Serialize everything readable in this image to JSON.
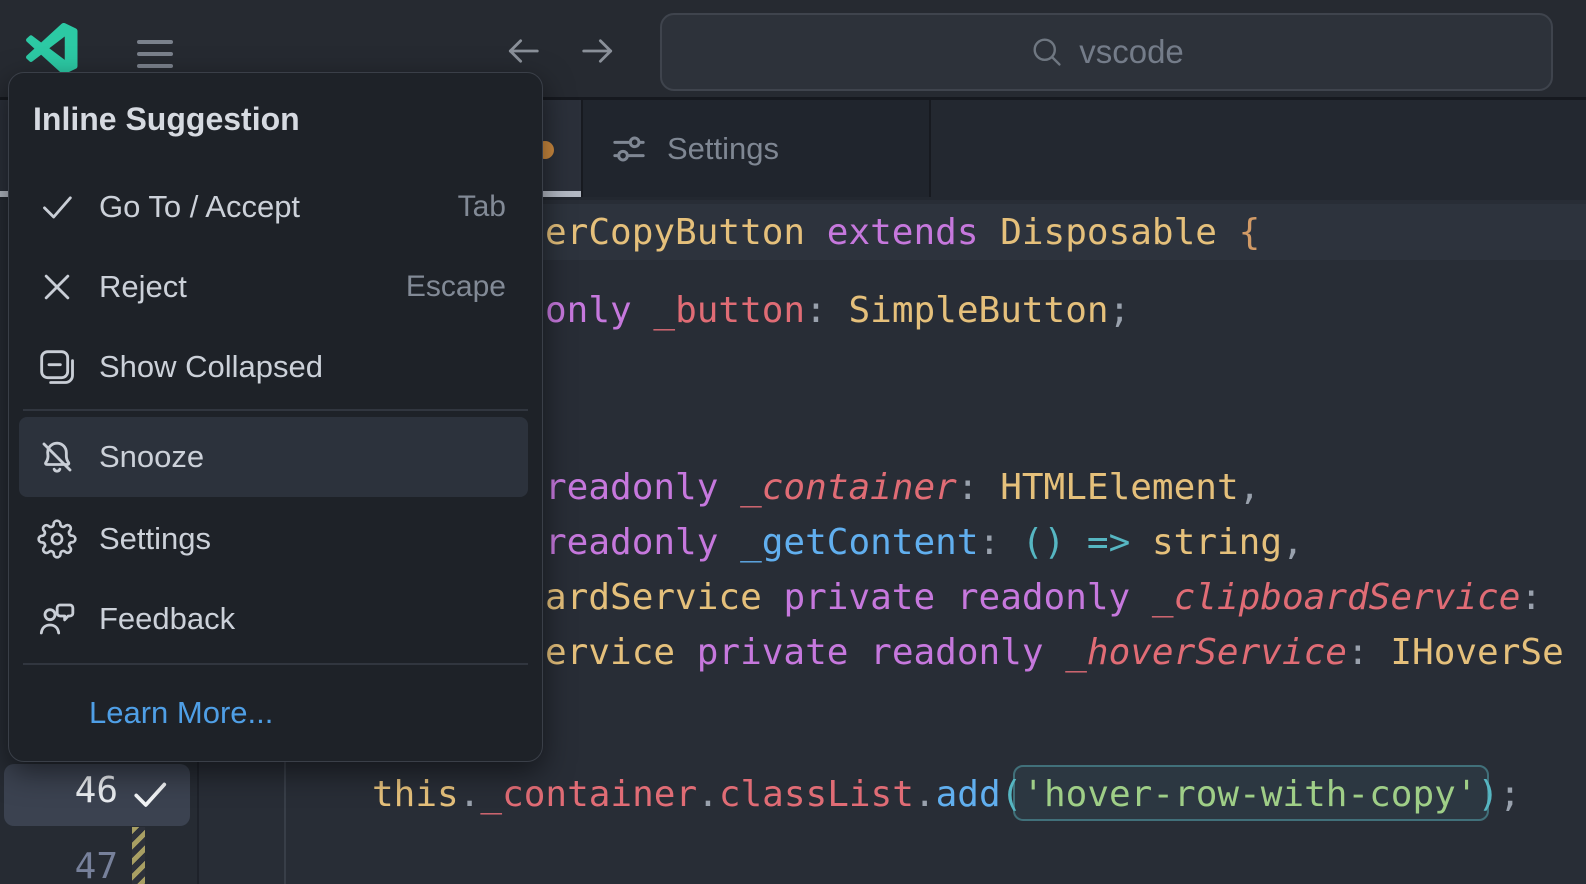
{
  "title_bar": {
    "logo_icon": "vscode-logo-icon",
    "menu_icon": "hamburger-icon",
    "back_icon": "arrow-left-icon",
    "forward_icon": "arrow-right-icon",
    "search": {
      "icon": "search-icon",
      "value": "vscode"
    }
  },
  "tab_bar": {
    "active_tab_modified_dot_color": "#cd8a3f",
    "settings_tab": {
      "icon": "sliders-icon",
      "label": "Settings"
    }
  },
  "menu": {
    "header": "Inline Suggestion",
    "items": [
      {
        "icon": "check-icon",
        "label": "Go To / Accept",
        "shortcut": "Tab"
      },
      {
        "icon": "x-icon",
        "label": "Reject",
        "shortcut": "Escape"
      },
      {
        "icon": "collapse-icon",
        "label": "Show Collapsed"
      },
      {
        "icon": "bell-slash-icon",
        "label": "Snooze",
        "highlighted": true
      },
      {
        "icon": "gear-icon",
        "label": "Settings"
      },
      {
        "icon": "comment-person-icon",
        "label": "Feedback"
      }
    ],
    "link": "Learn More...",
    "link_color": "#4f9fe6"
  },
  "editor": {
    "gutter": {
      "line_current": "46",
      "line_next": "47",
      "check_icon": "check-icon"
    },
    "code_lines": {
      "class_decl": [
        {
          "t": "erCopyButton",
          "c": "type"
        },
        {
          "t": " ",
          "c": "plain"
        },
        {
          "t": "extends",
          "c": "kw"
        },
        {
          "t": " ",
          "c": "plain"
        },
        {
          "t": "Disposable",
          "c": "type"
        },
        {
          "t": " ",
          "c": "plain"
        },
        {
          "t": "{",
          "c": "brace"
        }
      ],
      "button_field": [
        {
          "t": "only",
          "c": "kw"
        },
        {
          "t": " ",
          "c": "plain"
        },
        {
          "t": "_button",
          "c": "var"
        },
        {
          "t": ":",
          "c": "pn"
        },
        {
          "t": " ",
          "c": "plain"
        },
        {
          "t": "SimpleButton",
          "c": "type"
        },
        {
          "t": ";",
          "c": "pn"
        }
      ],
      "container_param": [
        {
          "t": "readonly",
          "c": "kw"
        },
        {
          "t": " ",
          "c": "plain"
        },
        {
          "t": "_container",
          "c": "vari"
        },
        {
          "t": ":",
          "c": "pn"
        },
        {
          "t": " ",
          "c": "plain"
        },
        {
          "t": "HTMLElement",
          "c": "type"
        },
        {
          "t": ",",
          "c": "pn"
        }
      ],
      "getcontent_param": [
        {
          "t": "readonly",
          "c": "kw"
        },
        {
          "t": " ",
          "c": "plain"
        },
        {
          "t": "_getContent",
          "c": "fn"
        },
        {
          "t": ":",
          "c": "pn"
        },
        {
          "t": " ",
          "c": "plain"
        },
        {
          "t": "()",
          "c": "teal"
        },
        {
          "t": " ",
          "c": "plain"
        },
        {
          "t": "=>",
          "c": "teal"
        },
        {
          "t": " ",
          "c": "plain"
        },
        {
          "t": "string",
          "c": "type"
        },
        {
          "t": ",",
          "c": "pn"
        }
      ],
      "clipboard_param": [
        {
          "t": "ardService",
          "c": "type"
        },
        {
          "t": " ",
          "c": "plain"
        },
        {
          "t": "private",
          "c": "kw"
        },
        {
          "t": " ",
          "c": "plain"
        },
        {
          "t": "readonly",
          "c": "kw"
        },
        {
          "t": " ",
          "c": "plain"
        },
        {
          "t": "_clipboardService",
          "c": "vari"
        },
        {
          "t": ":",
          "c": "pn"
        }
      ],
      "hover_param": [
        {
          "t": "ervice",
          "c": "type"
        },
        {
          "t": " ",
          "c": "plain"
        },
        {
          "t": "private",
          "c": "kw"
        },
        {
          "t": " ",
          "c": "plain"
        },
        {
          "t": "readonly",
          "c": "kw"
        },
        {
          "t": " ",
          "c": "plain"
        },
        {
          "t": "_hoverService",
          "c": "vari"
        },
        {
          "t": ":",
          "c": "pn"
        },
        {
          "t": " ",
          "c": "plain"
        },
        {
          "t": "IHoverSe",
          "c": "type"
        }
      ],
      "add_class_call": [
        {
          "t": "this",
          "c": "type"
        },
        {
          "t": ".",
          "c": "pn"
        },
        {
          "t": "_container",
          "c": "var"
        },
        {
          "t": ".",
          "c": "pn"
        },
        {
          "t": "classList",
          "c": "var"
        },
        {
          "t": ".",
          "c": "pn"
        },
        {
          "t": "add",
          "c": "fn"
        },
        {
          "t": "(",
          "c": "teal"
        },
        {
          "t": "'hover-row-with-copy'",
          "c": "str"
        },
        {
          "t": ")",
          "c": "teal"
        },
        {
          "t": ";",
          "c": "pn"
        }
      ]
    },
    "colors": {
      "keyword": "#c678dd",
      "type": "#e5c07b",
      "variable": "#e06c75",
      "function": "#61afef",
      "string": "#9fce87",
      "punctuation": "#99a1ad",
      "editor_bg": "#282d36",
      "current_line_bg": "#2d333d",
      "menu_bg": "#1e2228"
    }
  }
}
